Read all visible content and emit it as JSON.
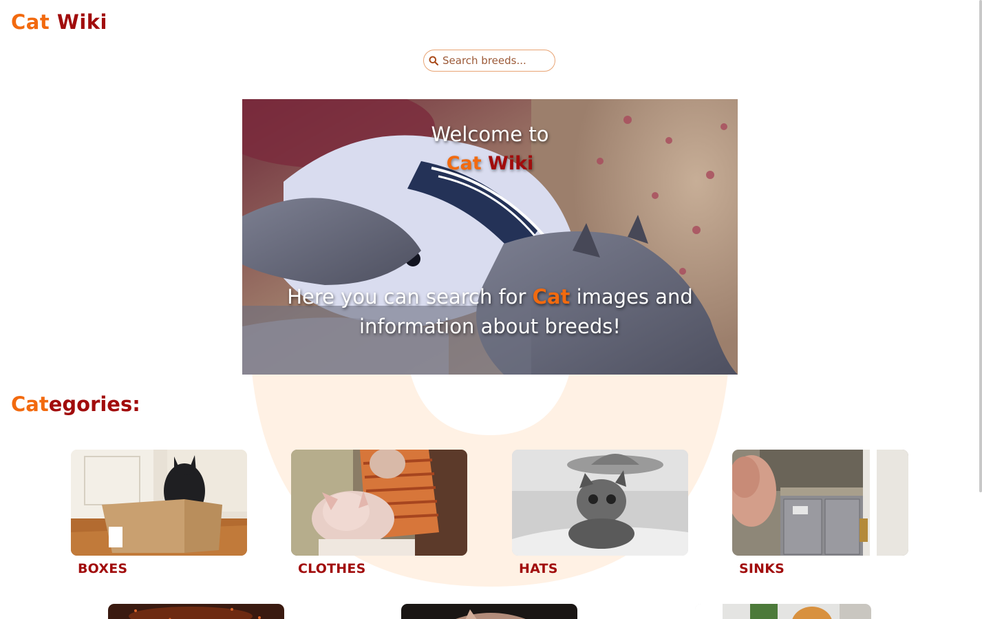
{
  "header": {
    "logo_part1": "Cat",
    "logo_part2": "Wiki"
  },
  "search": {
    "placeholder": "Search breeds..."
  },
  "hero": {
    "welcome": "Welcome to",
    "brand_part1": "Cat",
    "brand_part2": "Wiki",
    "text_before": "Here you can search for ",
    "text_highlight": "Cat",
    "text_after": " images and information about breeds!"
  },
  "categories": {
    "heading_part1": "Cat",
    "heading_part2": "egories:",
    "items": [
      {
        "label": "BOXES",
        "thumb": "black cat in cardboard box"
      },
      {
        "label": "CLOTHES",
        "thumb": "hairless cat in sweater"
      },
      {
        "label": "HATS",
        "thumb": "kitten wearing sombrero"
      },
      {
        "label": "SINKS",
        "thumb": "bathroom sink cabinet"
      }
    ]
  },
  "colors": {
    "brand_orange": "#f26a0f",
    "brand_red": "#a10c0c",
    "watermark": "#fff1e4"
  }
}
